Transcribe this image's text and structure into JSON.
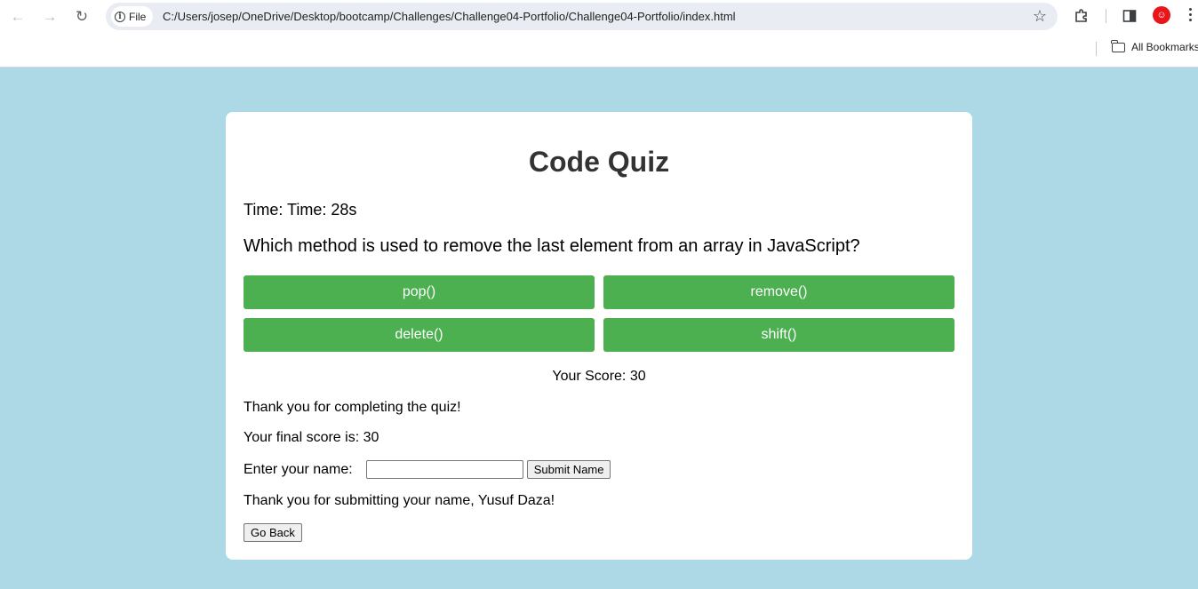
{
  "browser": {
    "url_scheme_chip": "File",
    "url": "C:/Users/josep/OneDrive/Desktop/bootcamp/Challenges/Challenge04-Portfolio/Challenge04-Portfolio/index.html",
    "bookmarks_label": "All Bookmarks",
    "accent_color": "#e8151b"
  },
  "quiz": {
    "title": "Code Quiz",
    "timer_text": "Time: Time: 28s",
    "question": "Which method is used to remove the last element from an array in JavaScript?",
    "choices": [
      "pop()",
      "remove()",
      "delete()",
      "shift()"
    ],
    "choice_color": "#4caf50",
    "score_text": "Your Score: 30",
    "thanks_text": "Thank you for completing the quiz!",
    "final_score_text": "Your final score is: 30",
    "name_label": "Enter your name:",
    "name_value": "",
    "submit_label": "Submit Name",
    "submitted_text": "Thank you for submitting your name, Yusuf Daza!",
    "back_label": "Go Back"
  },
  "theme": {
    "page_background": "#add8e6",
    "card_background": "#ffffff",
    "title_color": "#333333"
  }
}
